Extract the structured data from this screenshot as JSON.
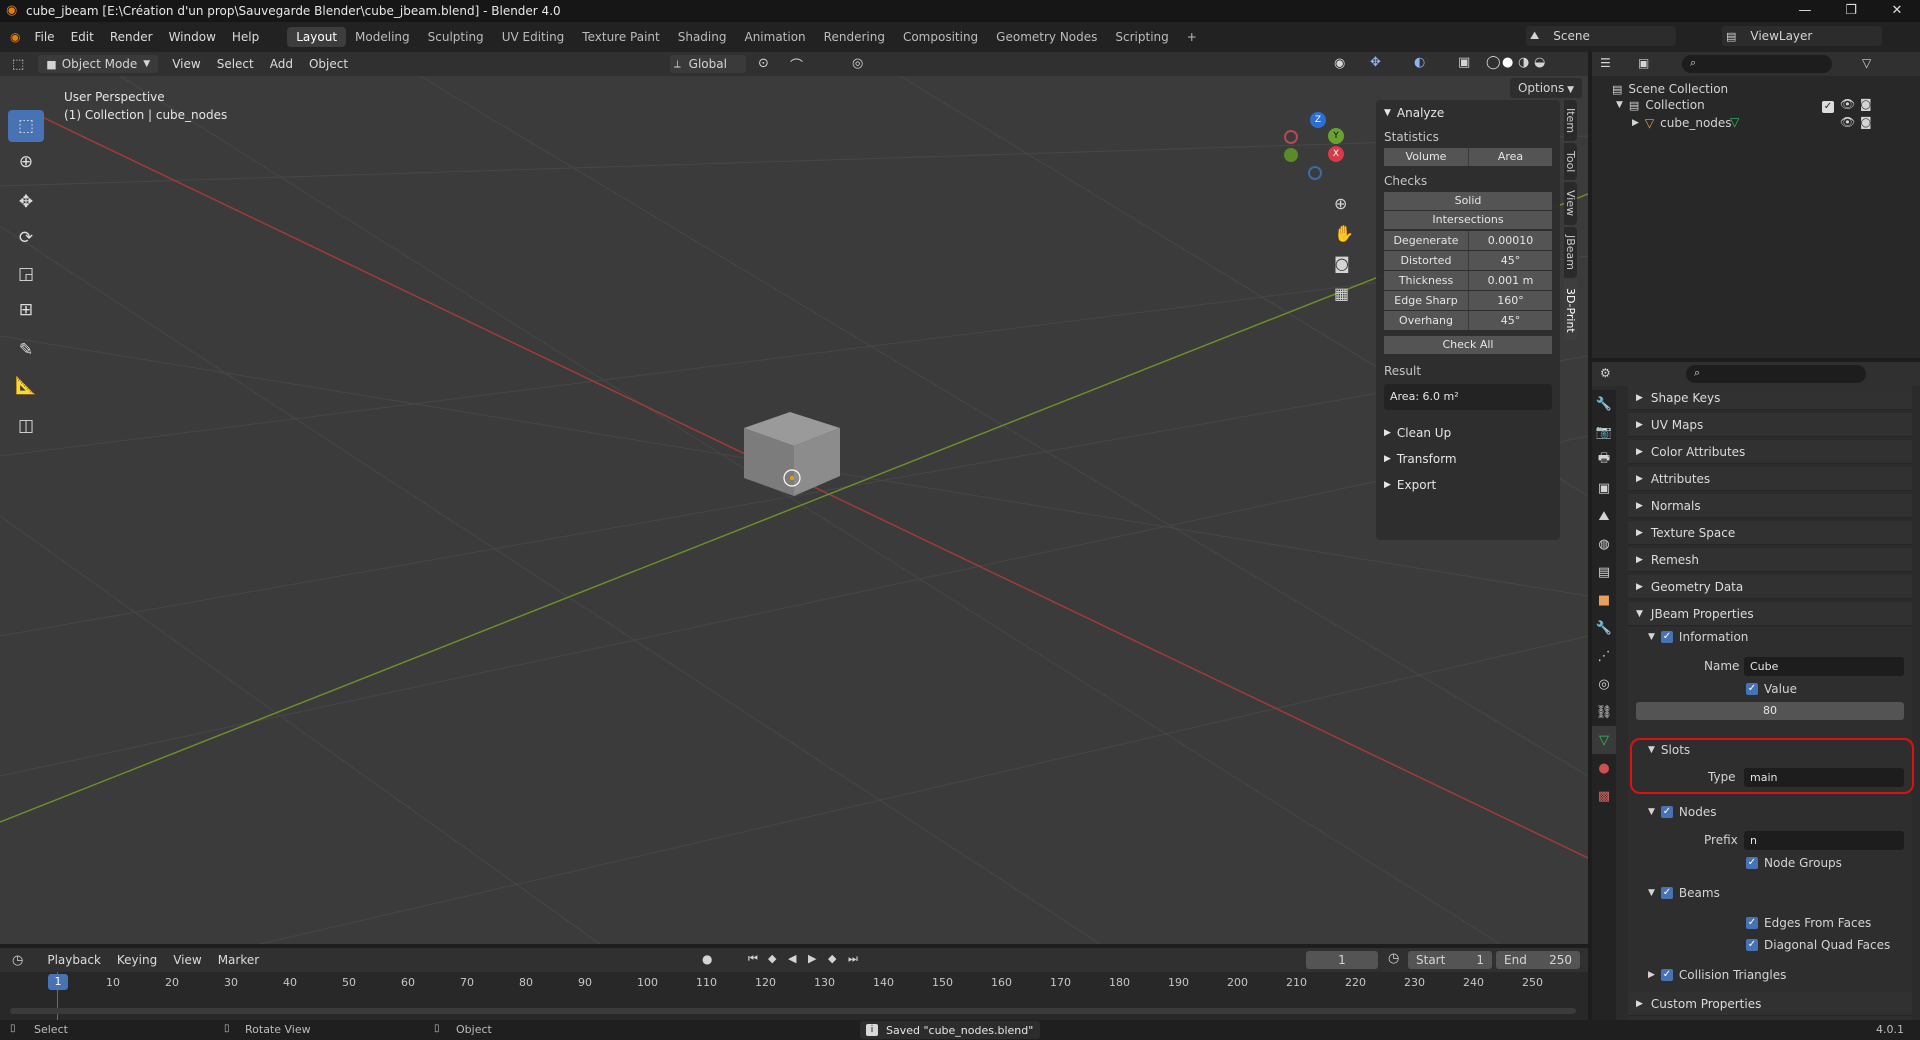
{
  "titlebar": {
    "title": "cube_jbeam [E:\\Création d'un prop\\Sauvegarde Blender\\cube_jbeam.blend] - Blender 4.0",
    "minimize": "—",
    "maximize": "❐",
    "close": "✕"
  },
  "menu": {
    "items": [
      "File",
      "Edit",
      "Render",
      "Window",
      "Help"
    ],
    "workspaces": [
      "Layout",
      "Modeling",
      "Sculpting",
      "UV Editing",
      "Texture Paint",
      "Shading",
      "Animation",
      "Rendering",
      "Compositing",
      "Geometry Nodes",
      "Scripting"
    ],
    "active_workspace": "Layout",
    "add_tab": "+",
    "scene": "Scene",
    "view_layer": "ViewLayer"
  },
  "viewport_header": {
    "mode": "Object Mode",
    "menus": [
      "View",
      "Select",
      "Add",
      "Object"
    ],
    "orientation": "Global",
    "options": "Options"
  },
  "viewport": {
    "perspective": "User Perspective",
    "collection_info": "(1) Collection | cube_nodes",
    "gizmo": {
      "x": "X",
      "y": "Y",
      "z": "Z"
    }
  },
  "npanel": {
    "analyze": "Analyze",
    "statistics": "Statistics",
    "volume": "Volume",
    "area": "Area",
    "checks": "Checks",
    "solid": "Solid",
    "intersections": "Intersections",
    "rows": [
      {
        "label": "Degenerate",
        "value": "0.00010"
      },
      {
        "label": "Distorted",
        "value": "45°"
      },
      {
        "label": "Thickness",
        "value": "0.001 m"
      },
      {
        "label": "Edge Sharp",
        "value": "160°"
      },
      {
        "label": "Overhang",
        "value": "45°"
      }
    ],
    "check_all": "Check All",
    "result": "Result",
    "result_value": "Area: 6.0 m²",
    "clean_up": "Clean Up",
    "transform": "Transform",
    "export": "Export",
    "tabs": [
      "Item",
      "Tool",
      "View",
      "JBeam",
      "3D-Print"
    ],
    "active_tab": "3D-Print"
  },
  "outliner": {
    "scene_collection": "Scene Collection",
    "collection": "Collection",
    "object": "cube_nodes"
  },
  "properties": {
    "sections": [
      "Shape Keys",
      "UV Maps",
      "Color Attributes",
      "Attributes",
      "Normals",
      "Texture Space",
      "Remesh",
      "Geometry Data"
    ],
    "jbeam": "JBeam Properties",
    "information": "Information",
    "name_label": "Name",
    "name_value": "Cube",
    "value_label": "Value",
    "value_number": "80",
    "slots": "Slots",
    "type_label": "Type",
    "type_value": "main",
    "nodes": "Nodes",
    "prefix_label": "Prefix",
    "prefix_value": "n",
    "node_groups": "Node Groups",
    "beams": "Beams",
    "edges_from_faces": "Edges From Faces",
    "diagonal_quad_faces": "Diagonal Quad Faces",
    "collision_triangles": "Collision Triangles",
    "custom_properties": "Custom Properties",
    "highlight_color": "#e01010"
  },
  "timeline": {
    "menus": [
      "Playback",
      "Keying",
      "View",
      "Marker"
    ],
    "current_frame": "1",
    "start_label": "Start",
    "start": "1",
    "end_label": "End",
    "end": "250",
    "ticks": [
      "10",
      "20",
      "30",
      "40",
      "50",
      "60",
      "70",
      "80",
      "90",
      "100",
      "110",
      "120",
      "130",
      "140",
      "150",
      "160",
      "170",
      "180",
      "190",
      "200",
      "210",
      "220",
      "230",
      "240",
      "250"
    ],
    "playhead": "1"
  },
  "statusbar": {
    "select": "Select",
    "rotate": "Rotate View",
    "object": "Object",
    "message": "Saved \"cube_nodes.blend\"",
    "version": "4.0.1"
  }
}
